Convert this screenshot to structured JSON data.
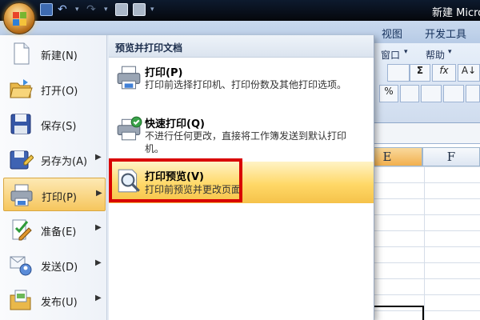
{
  "window": {
    "title": "新建 Micro"
  },
  "quick_access": {
    "save_icon": "save-icon",
    "undo_icon": "undo-icon",
    "redo_icon": "redo-icon",
    "customize_glyph": "▾"
  },
  "ribbon": {
    "tabs": [
      "视图",
      "开发工具"
    ],
    "groups": {
      "window_label": "窗口",
      "help_label": "帮助"
    },
    "tools": [
      "Σ",
      "fx",
      "%",
      "A↓"
    ]
  },
  "sheet": {
    "column_headers": [
      "E",
      "F"
    ],
    "active_column": "E"
  },
  "office_menu": {
    "items": [
      {
        "label": "新建(N)",
        "icon": "new-document-icon",
        "has_submenu": false
      },
      {
        "label": "打开(O)",
        "icon": "open-folder-icon",
        "has_submenu": false
      },
      {
        "label": "保存(S)",
        "icon": "save-floppy-icon",
        "has_submenu": false
      },
      {
        "label": "另存为(A)",
        "icon": "save-as-icon",
        "has_submenu": true
      },
      {
        "label": "打印(P)",
        "icon": "printer-icon",
        "has_submenu": true,
        "active": true
      },
      {
        "label": "准备(E)",
        "icon": "prepare-icon",
        "has_submenu": true
      },
      {
        "label": "发送(D)",
        "icon": "send-icon",
        "has_submenu": true
      },
      {
        "label": "发布(U)",
        "icon": "publish-icon",
        "has_submenu": true
      }
    ],
    "arrow_glyph": "▶",
    "submenu": {
      "header": "预览并打印文档",
      "options": [
        {
          "title": "打印(P)",
          "description": "打印前选择打印机、打印份数及其他打印选项。",
          "icon": "printer-icon"
        },
        {
          "title": "快速打印(Q)",
          "description": "不进行任何更改，直接将工作簿发送到默认打印机。",
          "icon": "quick-print-icon"
        },
        {
          "title": "打印预览(V)",
          "description": "打印前预览并更改页面",
          "icon": "print-preview-icon",
          "highlighted": true
        }
      ]
    }
  },
  "colors": {
    "highlight": "#f6c65d",
    "annotation_box": "#d90000",
    "title_bar": "#05070c"
  }
}
